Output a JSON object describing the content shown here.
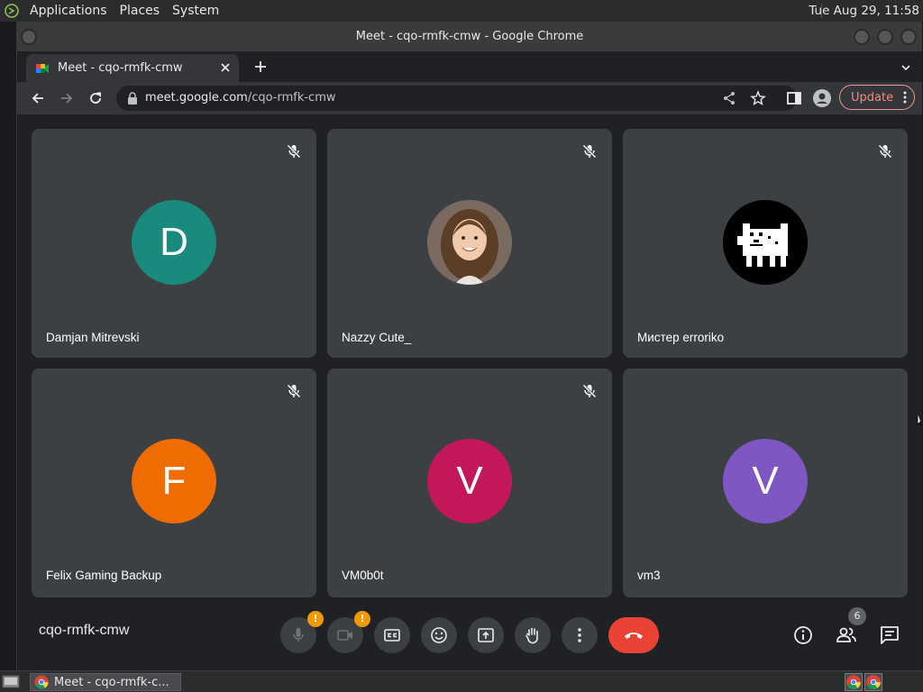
{
  "desktop": {
    "menus": [
      "Applications",
      "Places",
      "System"
    ],
    "clock": "Tue Aug 29, 11:58"
  },
  "window": {
    "title": "Meet - cqo-rmfk-cmw - Google Chrome"
  },
  "browser": {
    "tab_title": "Meet - cqo-rmfk-cmw",
    "url_host": "meet.google.com",
    "url_path": "/cqo-rmfk-cmw",
    "update_label": "Update"
  },
  "meet": {
    "meeting_code": "cqo-rmfk-cmw",
    "participants": [
      {
        "name": "Damjan Mitrevski",
        "initial": "D",
        "avatar_color": "#1a8a7c",
        "avatar_type": "initial",
        "muted": true
      },
      {
        "name": "Nazzy Cute_",
        "initial": "",
        "avatar_color": "#6b5a4e",
        "avatar_type": "photo",
        "muted": true
      },
      {
        "name": "Мистер erroriko",
        "initial": "",
        "avatar_color": "#000000",
        "avatar_type": "pixel-dog",
        "muted": true
      },
      {
        "name": "Felix Gaming Backup",
        "initial": "F",
        "avatar_color": "#ef6c00",
        "avatar_type": "initial",
        "muted": true
      },
      {
        "name": "VM0b0t",
        "initial": "V",
        "avatar_color": "#c2185b",
        "avatar_type": "initial",
        "muted": true
      },
      {
        "name": "vm3",
        "initial": "V",
        "avatar_color": "#7e57c2",
        "avatar_type": "initial",
        "muted": false
      }
    ],
    "controls": {
      "mic_badge": "!",
      "cam_badge": "!",
      "people_count": "6"
    }
  },
  "taskbar": {
    "task_label": "Meet - cqo-rmfk-c..."
  },
  "colors": {
    "meet_bg": "#202124",
    "tile_bg": "#3c4043",
    "leave_red": "#ea4335",
    "warning_orange": "#f29900"
  }
}
